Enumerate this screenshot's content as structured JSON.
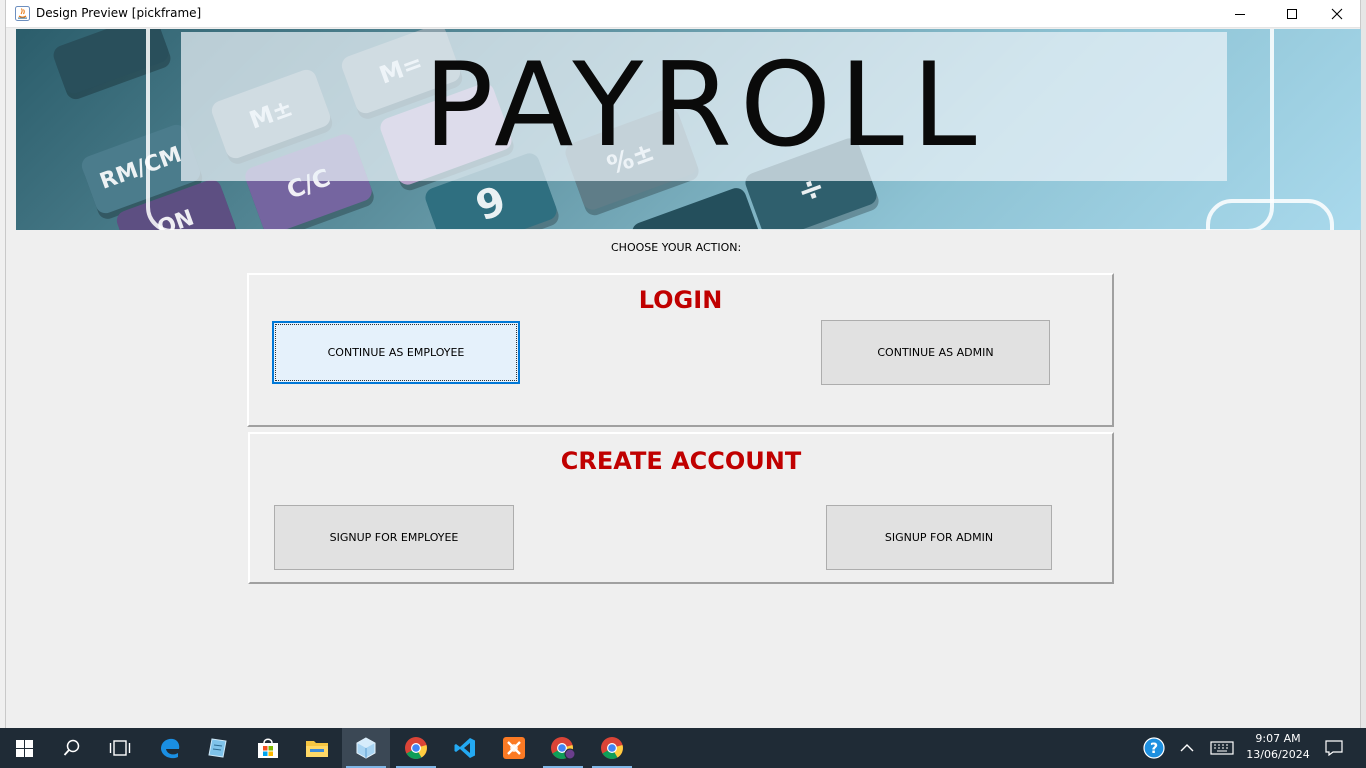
{
  "window": {
    "title": "Design Preview [pickframe]"
  },
  "banner": {
    "title": "PAYROLL",
    "keys": [
      "RM/CM",
      "M±",
      "M=",
      "ON",
      "C/C",
      "9",
      "%±",
      "÷"
    ]
  },
  "main": {
    "prompt": "CHOOSE YOUR ACTION:",
    "login": {
      "heading": "LOGIN",
      "employee_button": "CONTINUE AS EMPLOYEE",
      "admin_button": "CONTINUE AS ADMIN"
    },
    "create_account": {
      "heading": "CREATE ACCOUNT",
      "employee_button": "SIGNUP FOR EMPLOYEE",
      "admin_button": "SIGNUP FOR ADMIN"
    }
  },
  "taskbar": {
    "time": "9:07 AM",
    "date": "13/06/2024",
    "apps": [
      "start",
      "search",
      "task-view",
      "edge",
      "notepad",
      "store",
      "file-explorer",
      "netbeans",
      "chrome",
      "vscode",
      "xampp",
      "chrome-profile",
      "chrome"
    ]
  },
  "colors": {
    "heading_red": "#c00000",
    "focus_blue": "#0078d7",
    "taskbar_bg": "#1f2b36"
  }
}
